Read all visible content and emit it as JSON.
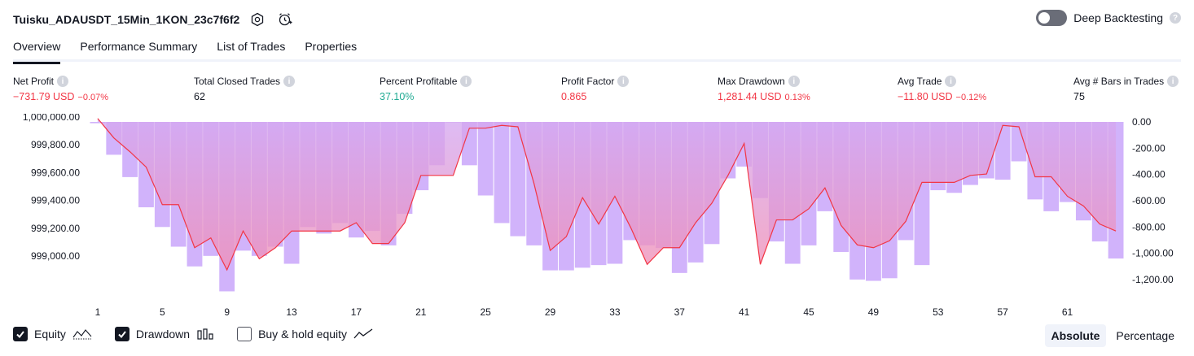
{
  "header": {
    "title": "Tuisku_ADAUSDT_15Min_1KON_23c7f6f2",
    "deep_backtesting": "Deep Backtesting"
  },
  "tabs": [
    {
      "label": "Overview"
    },
    {
      "label": "Performance Summary"
    },
    {
      "label": "List of Trades"
    },
    {
      "label": "Properties"
    }
  ],
  "stats": {
    "net_profit": {
      "label": "Net Profit",
      "value": "−731.79 USD",
      "pct": "−0.07%"
    },
    "total_closed_trades": {
      "label": "Total Closed Trades",
      "value": "62"
    },
    "percent_profitable": {
      "label": "Percent Profitable",
      "value": "37.10%"
    },
    "profit_factor": {
      "label": "Profit Factor",
      "value": "0.865"
    },
    "max_drawdown": {
      "label": "Max Drawdown",
      "value": "1,281.44 USD",
      "pct": "0.13%"
    },
    "avg_trade": {
      "label": "Avg Trade",
      "value": "−11.80 USD",
      "pct": "−0.12%"
    },
    "avg_bars": {
      "label": "Avg # Bars in Trades",
      "value": "75"
    }
  },
  "legend": {
    "equity": "Equity",
    "drawdown": "Drawdown",
    "buy_hold": "Buy & hold equity"
  },
  "mode": {
    "absolute": "Absolute",
    "percentage": "Percentage"
  },
  "colors": {
    "equity_line": "#f23645",
    "drawdown_bar": "#d1b3fb",
    "area_top": "#d4a8f2",
    "area_bottom": "#f08fb5",
    "profit_green": "#22ab94",
    "loss_red": "#f23645"
  },
  "chart_data": {
    "type": "area",
    "x_ticks": [
      "1",
      "5",
      "9",
      "13",
      "17",
      "21",
      "25",
      "29",
      "33",
      "37",
      "41",
      "45",
      "49",
      "53",
      "57",
      "61"
    ],
    "left_axis_ticks": [
      "1,000,000.00",
      "999,800.00",
      "999,600.00",
      "999,400.00",
      "999,200.00",
      "999,000.00"
    ],
    "right_axis_ticks": [
      "0.00",
      "-200.00",
      "-400.00",
      "-600.00",
      "-800.00",
      "-1,000.00",
      "-1,200.00"
    ],
    "equity_ylim": [
      998860,
      1000070
    ],
    "drawdown_ylim": [
      -1290,
      0
    ],
    "series": [
      {
        "name": "Equity",
        "x": [
          1,
          2,
          3,
          4,
          5,
          6,
          7,
          8,
          9,
          10,
          11,
          12,
          13,
          14,
          15,
          16,
          17,
          18,
          19,
          20,
          21,
          22,
          23,
          24,
          25,
          26,
          27,
          28,
          29,
          30,
          31,
          32,
          33,
          34,
          35,
          36,
          37,
          38,
          39,
          40,
          41,
          42,
          43,
          44,
          45,
          46,
          47,
          48,
          49,
          50,
          51,
          52,
          53,
          54,
          55,
          56,
          57,
          58,
          59,
          60,
          61,
          62,
          63,
          64
        ],
        "values": [
          999990,
          999850,
          999750,
          999640,
          999370,
          999370,
          999060,
          999130,
          998900,
          999180,
          998980,
          999060,
          999180,
          999180,
          999180,
          999180,
          999240,
          999090,
          999090,
          999240,
          999580,
          999580,
          999580,
          999920,
          999920,
          999940,
          999930,
          999520,
          999040,
          999140,
          999420,
          999230,
          999430,
          999200,
          998940,
          999060,
          999060,
          999240,
          999380,
          999580,
          999810,
          998940,
          999260,
          999260,
          999340,
          999490,
          999220,
          999080,
          999060,
          999110,
          999250,
          999530,
          999530,
          999530,
          999580,
          999590,
          999940,
          999930,
          999570,
          999570,
          999430,
          999360,
          999230,
          999180
        ]
      },
      {
        "name": "Drawdown",
        "x": [
          1,
          2,
          3,
          4,
          5,
          6,
          7,
          8,
          9,
          10,
          11,
          12,
          13,
          14,
          15,
          16,
          17,
          18,
          19,
          20,
          21,
          22,
          23,
          24,
          25,
          26,
          27,
          28,
          29,
          30,
          31,
          32,
          33,
          34,
          35,
          36,
          37,
          38,
          39,
          40,
          41,
          42,
          43,
          44,
          45,
          46,
          47,
          48,
          49,
          50,
          51,
          52,
          53,
          54,
          55,
          56,
          57,
          58,
          59,
          60,
          61,
          62,
          63,
          64
        ],
        "values": [
          -10,
          -250,
          -420,
          -650,
          -800,
          -950,
          -1100,
          -1020,
          -1290,
          -980,
          -1020,
          -950,
          -1080,
          -800,
          -850,
          -770,
          -880,
          -830,
          -940,
          -700,
          -520,
          -330,
          0,
          -330,
          -560,
          -770,
          -870,
          -940,
          -1130,
          -1130,
          -1110,
          -1090,
          -1080,
          -900,
          -940,
          -960,
          -1150,
          -1070,
          -930,
          -430,
          -340,
          -580,
          -910,
          -1080,
          -940,
          -680,
          -990,
          -1200,
          -1210,
          -1190,
          -900,
          -1090,
          -520,
          -540,
          -480,
          -430,
          -440,
          -300,
          -590,
          -680,
          -610,
          -750,
          -910,
          -1040
        ]
      }
    ]
  }
}
